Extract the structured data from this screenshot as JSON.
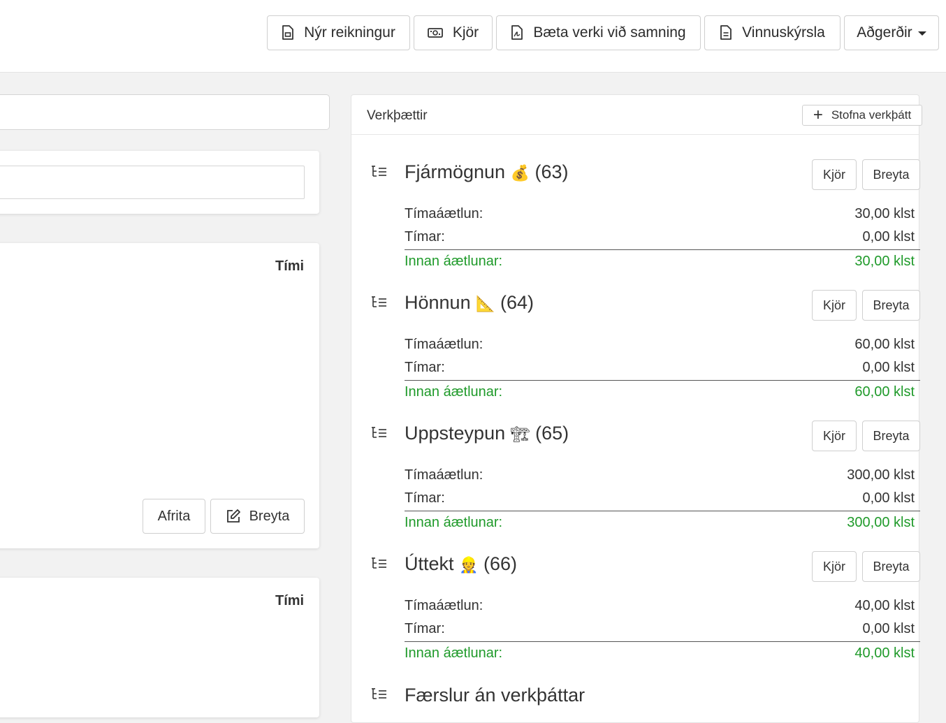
{
  "toolbar": {
    "new_invoice": "Nýr reikningur",
    "rates": "Kjör",
    "add_to_contract": "Bæta verki við samning",
    "work_report": "Vinnuskýrsla",
    "actions": "Aðgerðir"
  },
  "left": {
    "card1_col_head": "Tími",
    "copy_button": "Afrita",
    "edit_button": "Breyta",
    "card2_col_head": "Tími"
  },
  "phases_panel": {
    "title": "Verkþættir",
    "new_phase_button": "Stofna verkþátt",
    "rates_button": "Kjör",
    "edit_button": "Breyta",
    "label_estimate": "Tímaáætlun:",
    "label_hours": "Tímar:",
    "label_within": "Innan áætlunar:",
    "phases": [
      {
        "name": "Fjármögnun",
        "emoji": "💰",
        "number": "(63)",
        "estimate": "30,00 klst",
        "hours": "0,00 klst",
        "within": "30,00 klst"
      },
      {
        "name": "Hönnun",
        "emoji": "📐",
        "number": "(64)",
        "estimate": "60,00 klst",
        "hours": "0,00 klst",
        "within": "60,00 klst"
      },
      {
        "name": "Uppsteypun",
        "emoji": "🏗",
        "number": "(65)",
        "estimate": "300,00 klst",
        "hours": "0,00 klst",
        "within": "300,00 klst"
      },
      {
        "name": "Úttekt",
        "emoji": "👷",
        "number": "(66)",
        "estimate": "40,00 klst",
        "hours": "0,00 klst",
        "within": "40,00 klst"
      }
    ],
    "unassigned_title": "Færslur án verkþáttar"
  },
  "colors": {
    "accent_green": "#1f9a2a",
    "border": "#cfcfcf",
    "background": "#f2f2f2"
  }
}
